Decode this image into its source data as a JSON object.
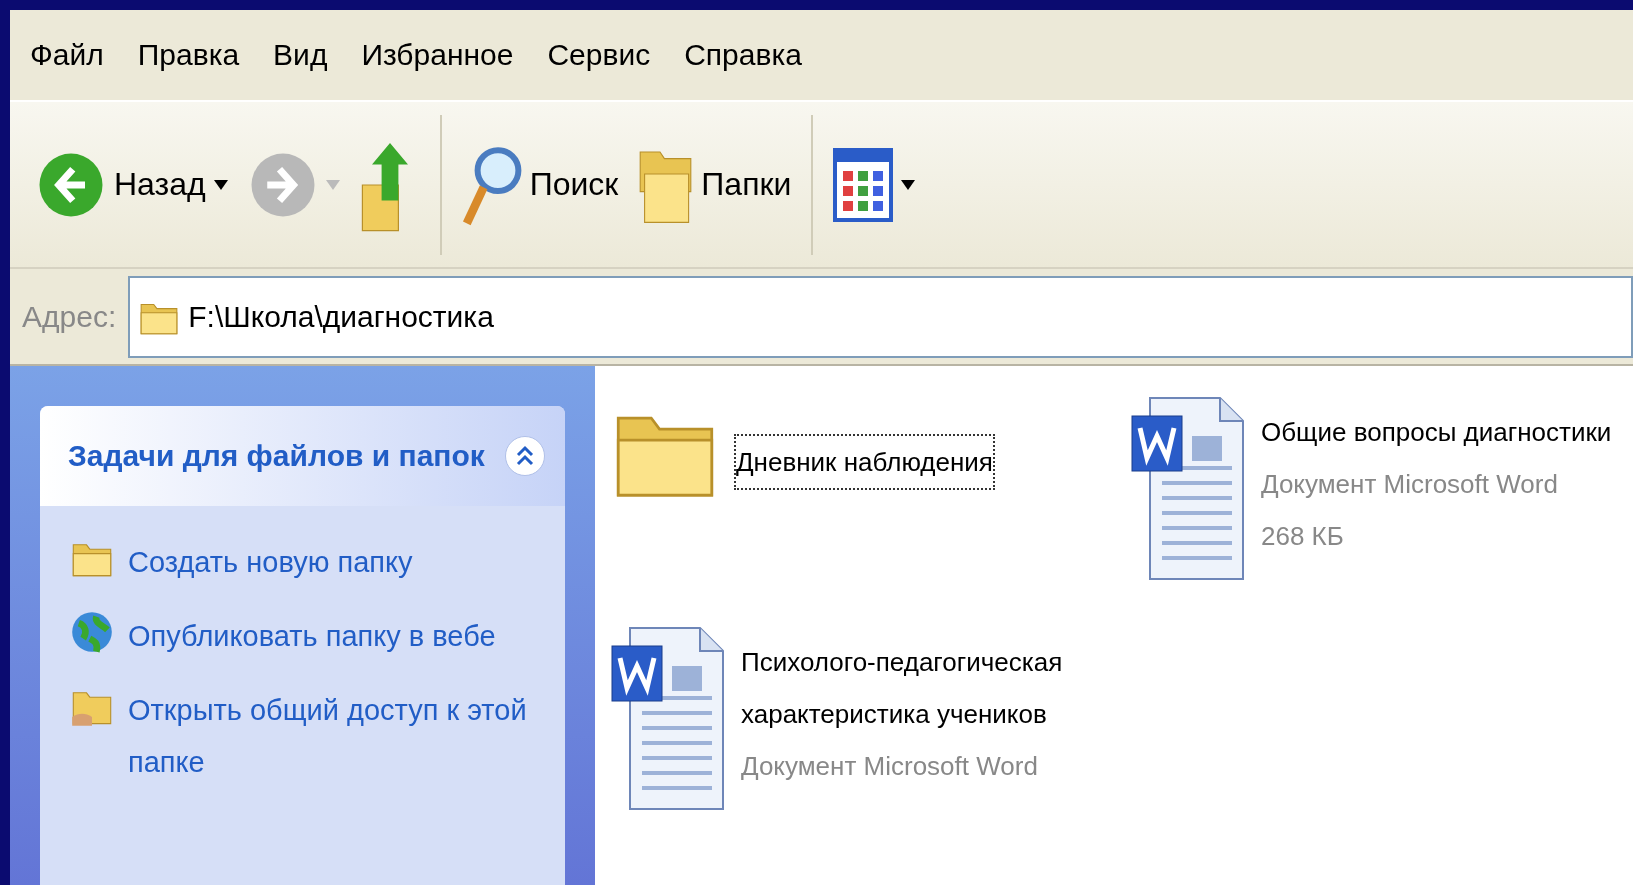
{
  "menu": [
    "Файл",
    "Правка",
    "Вид",
    "Избранное",
    "Сервис",
    "Справка"
  ],
  "toolbar": [
    {
      "kind": "back",
      "label": "Назад",
      "disabled": false
    },
    {
      "kind": "forward",
      "disabled": true
    },
    {
      "kind": "up",
      "disabled": false
    },
    {
      "kind": "search",
      "label": "Поиск",
      "disabled": false
    },
    {
      "kind": "folders",
      "label": "Папки",
      "disabled": false
    },
    {
      "kind": "views",
      "disabled": false
    }
  ],
  "address": {
    "label": "Адрес:",
    "value": "F:\\Школа\\диагностика"
  },
  "tasks": {
    "title": "Задачи для файлов и папок",
    "expanded": true,
    "items": [
      {
        "kind": "new-folder",
        "label": "Создать новую папку"
      },
      {
        "kind": "publish",
        "label": "Опубликовать папку в вебе"
      },
      {
        "kind": "share",
        "label": "Открыть общий доступ к этой папке"
      }
    ]
  },
  "files": [
    {
      "kind": "folder",
      "name": "Дневник наблюдения",
      "selected": true
    },
    {
      "kind": "word",
      "name": "Общие вопросы диагностики",
      "type": "Документ Microsoft Word",
      "size": "268 КБ",
      "selected": false
    },
    {
      "kind": "word",
      "name": "Психолого-педагогическая характеристика учеников",
      "type": "Документ Microsoft Word",
      "selected": false
    }
  ]
}
